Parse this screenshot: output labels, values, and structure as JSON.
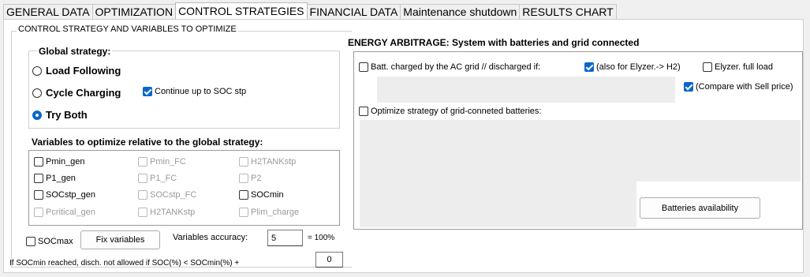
{
  "tabs": [
    {
      "label": "GENERAL DATA",
      "active": false
    },
    {
      "label": "OPTIMIZATION",
      "active": false
    },
    {
      "label": "CONTROL STRATEGIES",
      "active": true
    },
    {
      "label": "FINANCIAL DATA",
      "active": false
    },
    {
      "label": "Maintenance shutdown",
      "active": false
    },
    {
      "label": "RESULTS CHART",
      "active": false
    }
  ],
  "control": {
    "group_title": "CONTROL STRATEGY AND VARIABLES TO OPTIMIZE",
    "global_strategy": {
      "title": "Global strategy:",
      "options": [
        {
          "label": "Load Following",
          "selected": false
        },
        {
          "label": "Cycle Charging",
          "selected": false
        },
        {
          "label": "Try Both",
          "selected": true
        }
      ],
      "continue_soc": {
        "label": "Continue up to SOC stp",
        "checked": true
      }
    },
    "variables": {
      "title": "Variables to optimize relative to the global strategy:",
      "items": [
        {
          "label": "Pmin_gen",
          "checked": false,
          "enabled": true
        },
        {
          "label": "Pmin_FC",
          "checked": false,
          "enabled": false
        },
        {
          "label": "H2TANKstp",
          "checked": false,
          "enabled": false
        },
        {
          "label": "P1_gen",
          "checked": false,
          "enabled": true
        },
        {
          "label": "P1_FC",
          "checked": false,
          "enabled": false
        },
        {
          "label": "P2",
          "checked": false,
          "enabled": false
        },
        {
          "label": "SOCstp_gen",
          "checked": false,
          "enabled": true
        },
        {
          "label": "SOCstp_FC",
          "checked": false,
          "enabled": false
        },
        {
          "label": "SOCmin",
          "checked": false,
          "enabled": true
        },
        {
          "label": "Pcritical_gen",
          "checked": false,
          "enabled": false
        },
        {
          "label": "H2TANKstp",
          "checked": false,
          "enabled": false
        },
        {
          "label": "Plim_charge",
          "checked": false,
          "enabled": false
        }
      ]
    },
    "socmax": {
      "label": "SOCmax",
      "checked": false
    },
    "fix_variables_label": "Fix variables",
    "accuracy": {
      "label": "Variables accuracy:",
      "value": "5",
      "suffix": "= 100%"
    },
    "socmin_note": {
      "label": "If SOCmin reached, disch. not allowed if SOC(%) < SOCmin(%) +",
      "value": "0"
    }
  },
  "arbitrage": {
    "title": "ENERGY ARBITRAGE: System with batteries and grid connected",
    "batt_charged": {
      "label": "Batt. charged by the AC grid // discharged if:",
      "checked": false
    },
    "elyzer_h2": {
      "label": "(also for Elyzer.-> H2)",
      "checked": true
    },
    "elyzer_full": {
      "label": "Elyzer. full load",
      "checked": false
    },
    "compare_sell": {
      "label": "(Compare with Sell price)",
      "checked": true
    },
    "optimize_grid": {
      "label": "Optimize strategy of grid-conneted batteries:",
      "checked": false
    },
    "batteries_availability_label": "Batteries availability"
  }
}
